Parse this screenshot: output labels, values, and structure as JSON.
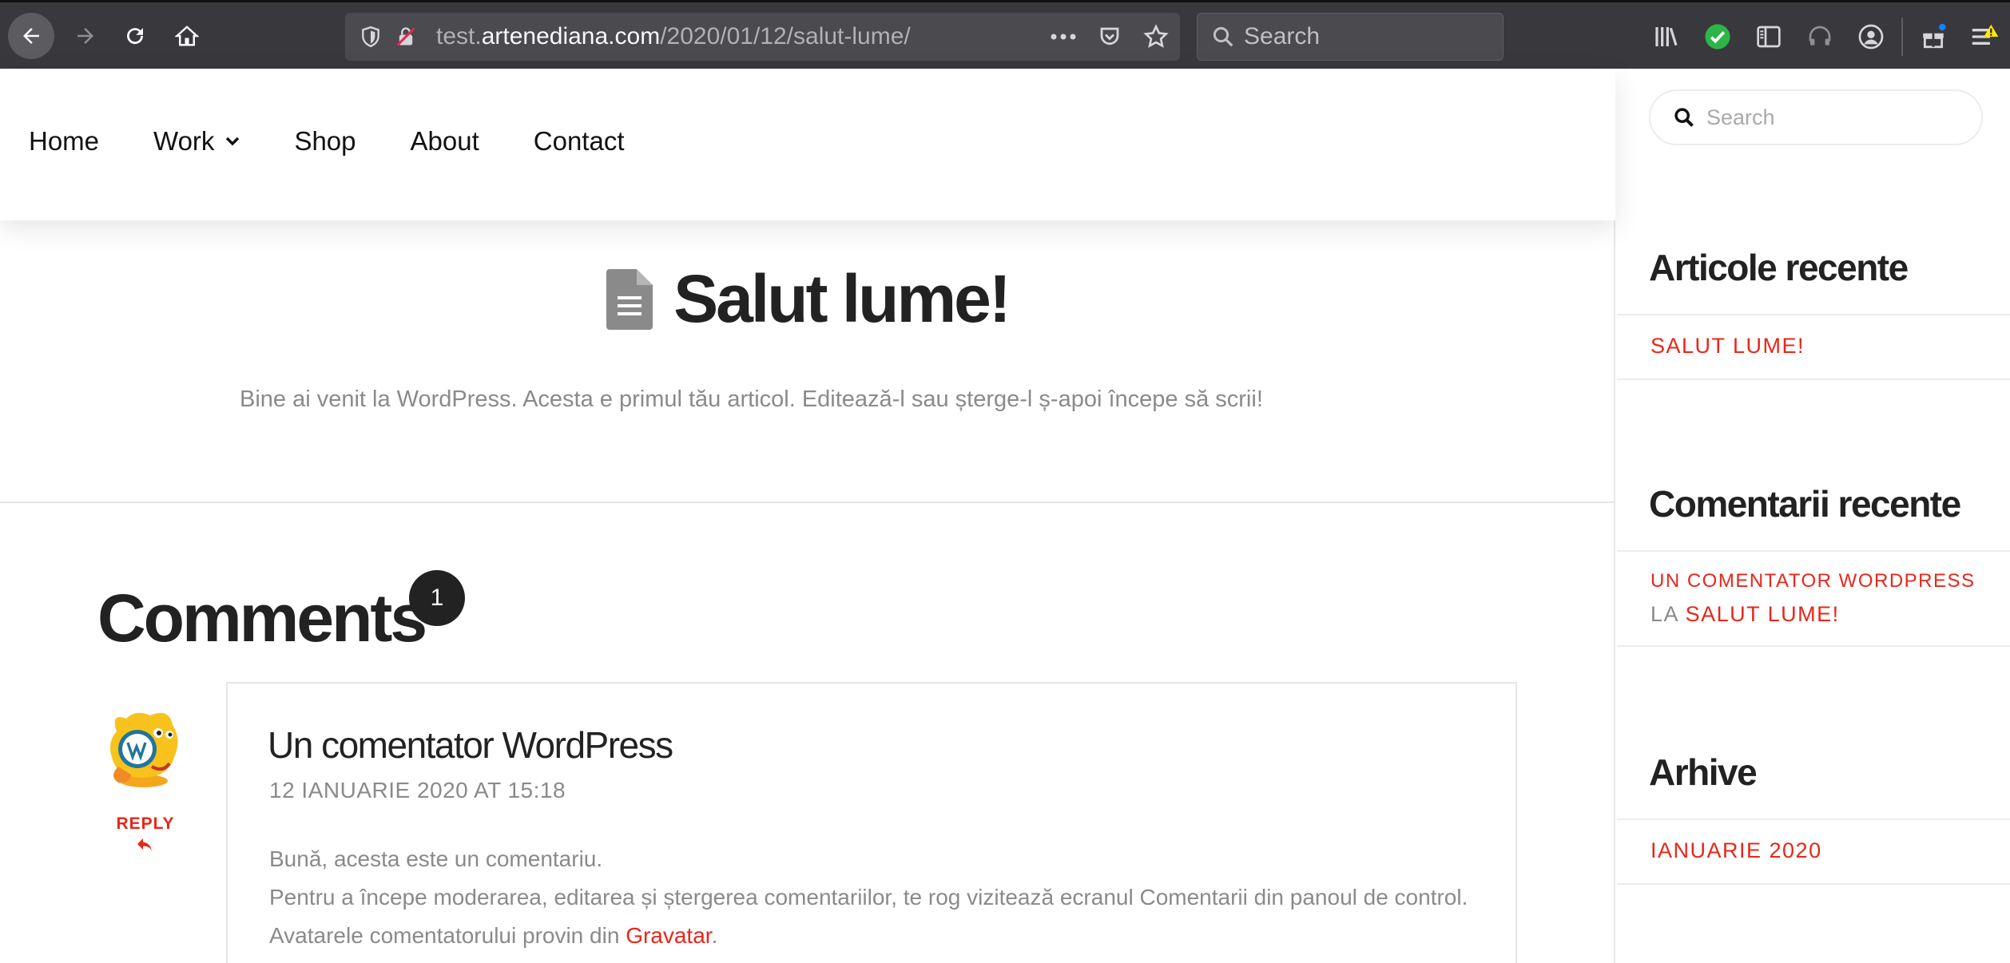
{
  "browser": {
    "url_prefix": "test.",
    "url_host": "artenediana.com",
    "url_path": "/2020/01/12/salut-lume/",
    "search_placeholder": "Search"
  },
  "nav": {
    "items": [
      {
        "label": "Home"
      },
      {
        "label": "Work"
      },
      {
        "label": "Shop"
      },
      {
        "label": "About"
      },
      {
        "label": "Contact"
      }
    ]
  },
  "post": {
    "title": "Salut lume!",
    "excerpt": "Bine ai venit la WordPress. Acesta e primul tău articol. Editează-l sau șterge-l ș-apoi începe să scrii!"
  },
  "comments": {
    "heading": "Comments",
    "count": "1",
    "items": [
      {
        "author": "Un comentator WordPress",
        "date": "12 IANUARIE 2020 AT 15:18",
        "reply_label": "REPLY",
        "line1": "Bună, acesta este un comentariu.",
        "line2": "Pentru a începe moderarea, editarea și ștergerea comentariilor, te rog vizitează ecranul Comentarii din panoul de control.",
        "line3_prefix": "Avatarele comentatorului provin din ",
        "line3_link": "Gravatar",
        "line3_suffix": "."
      }
    ]
  },
  "sidebar": {
    "search_placeholder": "Search",
    "recent_posts": {
      "title": "Articole recente",
      "items": [
        "SALUT LUME!"
      ]
    },
    "recent_comments": {
      "title": "Comentarii recente",
      "author": "UN COMENTATOR WORDPRESS",
      "connector": "LA",
      "post": "SALUT LUME!"
    },
    "archives": {
      "title": "Arhive",
      "items": [
        "IANUARIE 2020"
      ]
    }
  },
  "colors": {
    "accent": "#e8261a",
    "chrome": "#38383d",
    "text": "#222222",
    "muted": "#8a8a8a"
  }
}
